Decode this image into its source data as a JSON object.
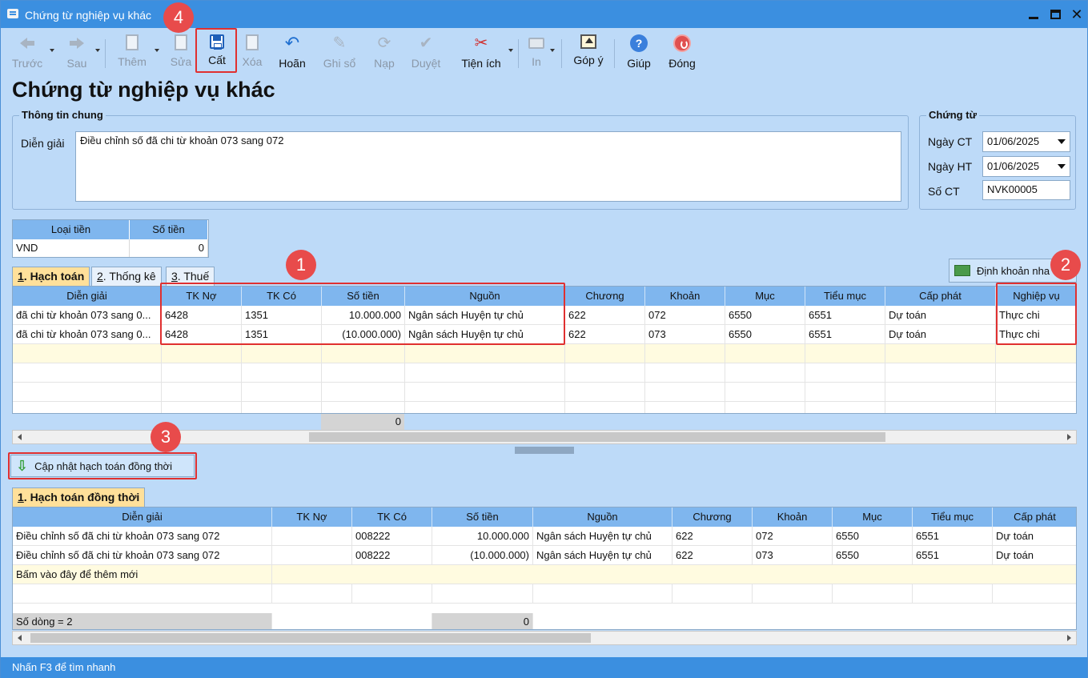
{
  "window": {
    "title": "Chứng từ nghiệp vụ khác"
  },
  "toolbar": {
    "prev": "Trước",
    "next": "Sau",
    "add": "Thêm",
    "edit": "Sửa",
    "save": "Cất",
    "delete": "Xóa",
    "undo": "Hoãn",
    "post": "Ghi sổ",
    "load": "Nạp",
    "approve": "Duyệt",
    "utilities": "Tiện ích",
    "print": "In",
    "feedback": "Góp ý",
    "help": "Giúp",
    "close": "Đóng"
  },
  "page_title": "Chứng từ nghiệp vụ khác",
  "general_info": {
    "title": "Thông tin chung",
    "description_label": "Diễn giải",
    "description_value": "Điều chỉnh số đã chi từ khoản 073 sang 072"
  },
  "voucher": {
    "title": "Chứng từ",
    "date_ct_label": "Ngày CT",
    "date_ct_value": "01/06/2025",
    "date_ht_label": "Ngày HT",
    "date_ht_value": "01/06/2025",
    "number_label": "Số CT",
    "number_value": "NVK00005"
  },
  "money": {
    "col_currency": "Loại tiền",
    "col_amount": "Số tiền",
    "currency": "VND",
    "amount": "0"
  },
  "tabs_top": [
    {
      "key": "1",
      "rest": ". Hạch toán"
    },
    {
      "key": "2",
      "rest": ". Thống kê"
    },
    {
      "key": "3",
      "rest": ". Thuế"
    }
  ],
  "auto_entry_button": "Định khoản nha",
  "grid1": {
    "headers": [
      "Diễn giải",
      "TK Nợ",
      "TK Có",
      "Số tiền",
      "Nguồn",
      "Chương",
      "Khoản",
      "Mục",
      "Tiểu mục",
      "Cấp phát",
      "Nghiệp vụ"
    ],
    "rows": [
      [
        "đã chi từ khoản 073 sang 0...",
        "6428",
        "1351",
        "10.000.000",
        "Ngân sách Huyện tự chủ",
        "622",
        "072",
        "6550",
        "6551",
        "Dự toán",
        "Thực chi"
      ],
      [
        "đã chi từ khoản 073 sang 0...",
        "6428",
        "1351",
        "(10.000.000)",
        "Ngân sách Huyện tự chủ",
        "622",
        "073",
        "6550",
        "6551",
        "Dự toán",
        "Thực chi"
      ]
    ],
    "total": "0"
  },
  "update_button": "Cập nhật hạch toán đồng thời",
  "tab_bottom": {
    "key": "1",
    "rest": ". Hạch toán đồng thời"
  },
  "grid2": {
    "headers": [
      "Diễn giải",
      "TK Nợ",
      "TK Có",
      "Số tiền",
      "Nguồn",
      "Chương",
      "Khoản",
      "Mục",
      "Tiểu mục",
      "Cấp phát"
    ],
    "rows": [
      [
        "Điều chỉnh số đã chi từ khoản 073 sang 072",
        "",
        "008222",
        "10.000.000",
        "Ngân sách Huyện tự chủ",
        "622",
        "072",
        "6550",
        "6551",
        "Dự toán"
      ],
      [
        "Điều chỉnh số đã chi từ khoản 073 sang 072",
        "",
        "008222",
        "(10.000.000)",
        "Ngân sách Huyện tự chủ",
        "622",
        "073",
        "6550",
        "6551",
        "Dự toán"
      ]
    ],
    "new_row_hint": "Bấm vào đây để thêm mới",
    "row_count": "Số dòng = 2",
    "total": "0"
  },
  "status_bar": "Nhấn F3 để tìm nhanh",
  "markers": [
    "1",
    "2",
    "3",
    "4"
  ],
  "colors": {
    "titlebar": "#3b8fe0",
    "background": "#bddaf8",
    "grid_header": "#7fb6ee",
    "highlight": "#e03030",
    "marker": "#e84b4b"
  }
}
